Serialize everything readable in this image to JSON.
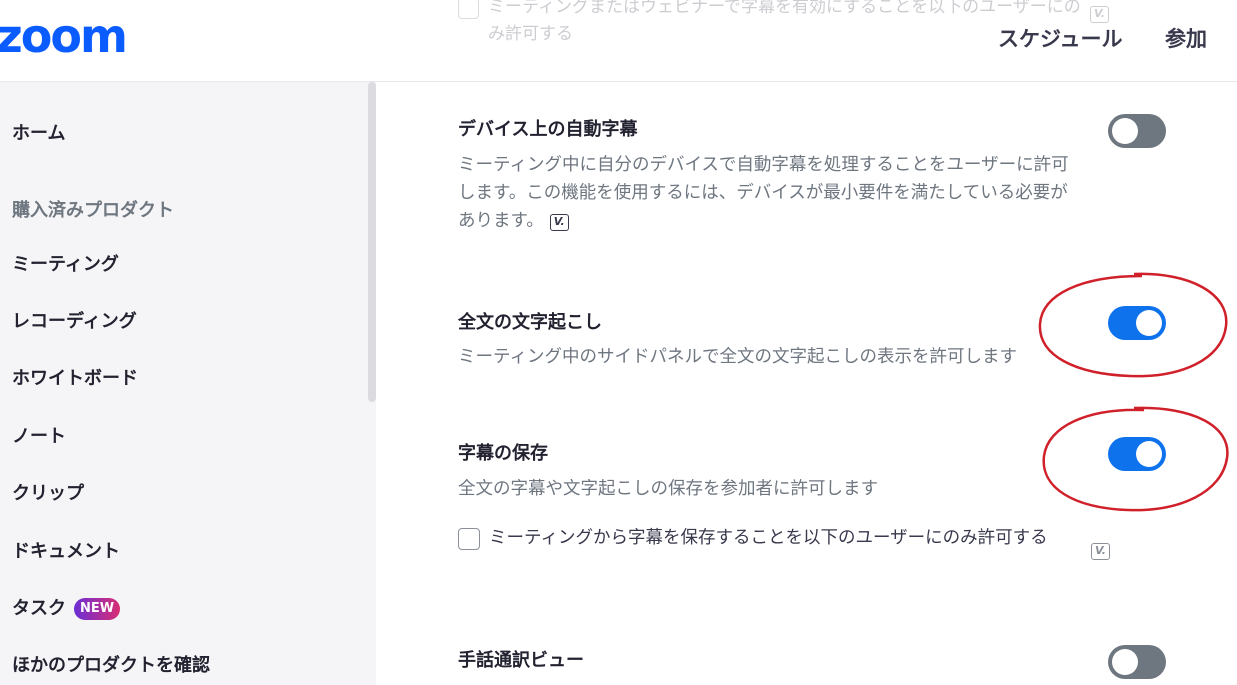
{
  "header": {
    "logo": "zoom",
    "schedule": "スケジュール",
    "join": "参加"
  },
  "ghost": {
    "text": "ミーティングまたはウェビナーで字幕を有効にすることを以下のユーザーにのみ許可する",
    "icon": "V."
  },
  "sidebar": {
    "home": "ホーム",
    "purchased_heading": "購入済みプロダクト",
    "items": [
      "ミーティング",
      "レコーディング",
      "ホワイトボード",
      "ノート",
      "クリップ",
      "ドキュメント",
      "タスク"
    ],
    "new_badge": "NEW",
    "explore": "ほかのプロダクトを確認"
  },
  "settings": [
    {
      "title": "デバイス上の自動字幕",
      "description": "ミーティング中に自分のデバイスで自動字幕を処理することをユーザーに許可します。この機能を使用するには、デバイスが最小要件を満たしている必要があります。",
      "enabled": false,
      "icon": "V."
    },
    {
      "title": "全文の文字起こし",
      "description": "ミーティング中のサイドパネルで全文の文字起こしの表示を許可します",
      "enabled": true
    },
    {
      "title": "字幕の保存",
      "description": "全文の字幕や文字起こしの保存を参加者に許可します",
      "enabled": true,
      "checkbox_label": "ミーティングから字幕を保存することを以下のユーザーにのみ許可する",
      "checkbox_checked": false,
      "icon": "V."
    },
    {
      "title": "手話通訳ビュー",
      "enabled": false
    }
  ],
  "colors": {
    "brand": "#0b5cff",
    "toggle_on": "#0e72ed",
    "toggle_off": "#6e7680",
    "annotation": "#d0202a"
  }
}
